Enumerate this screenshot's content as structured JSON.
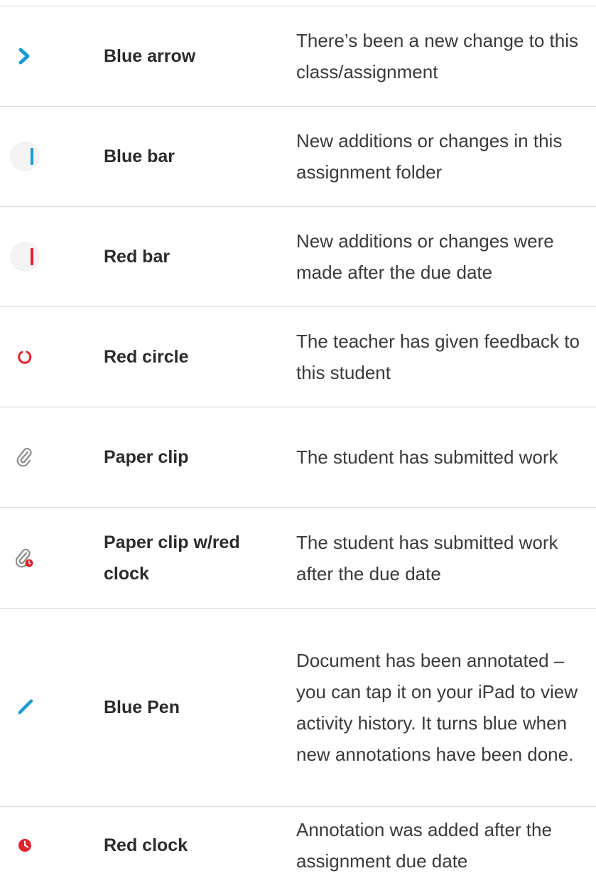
{
  "rows": [
    {
      "icon": "blue-arrow-icon",
      "name": "Blue arrow",
      "description": "There’s been a new change to this class/assignment"
    },
    {
      "icon": "blue-bar-icon",
      "name": "Blue bar",
      "description": "New additions or changes in this assignment folder"
    },
    {
      "icon": "red-bar-icon",
      "name": "Red bar",
      "description": "New additions or changes were made after the due date"
    },
    {
      "icon": "red-circle-icon",
      "name": "Red circle",
      "description": "The teacher has given feedback to this student"
    },
    {
      "icon": "paper-clip-icon",
      "name": "Paper clip",
      "description": "The student has submitted work"
    },
    {
      "icon": "paper-clip-red-clock-icon",
      "name": "Paper clip w/red clock",
      "description": "The student has submitted work after the due date"
    },
    {
      "icon": "blue-pen-icon",
      "name": "Blue Pen",
      "description": "Document has been annotated – you can tap it on your iPad to view activity history. It turns blue when new annotations have been done."
    },
    {
      "icon": "red-clock-icon",
      "name": "Red clock",
      "description": "Annotation was added after the assignment due date"
    }
  ],
  "colors": {
    "blue": "#1a9ad6",
    "red": "#e4212b",
    "gray": "#8a8a8a",
    "divider": "#d9d9d9"
  }
}
